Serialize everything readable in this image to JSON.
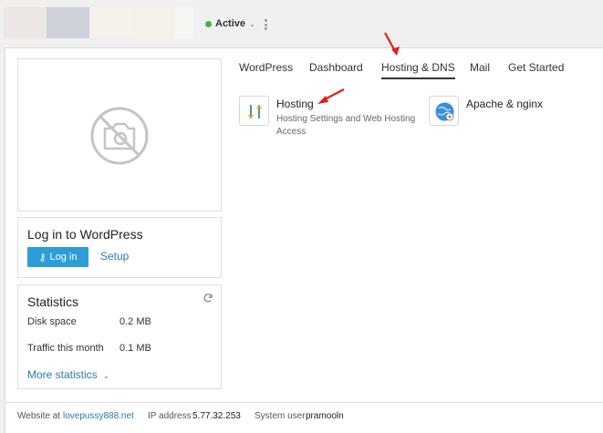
{
  "topbar": {
    "swatches": [
      "#ece7e4",
      "#cdd1da",
      "#f5f2ec",
      "#f4f2e8",
      "#f6f6f4"
    ],
    "status_label": "Active",
    "status_color": "#4caf50",
    "status_chevron": "⌄",
    "menu_icon": "kebab-menu-icon"
  },
  "preview": {
    "icon": "no-image-camera-icon"
  },
  "wordpress": {
    "title": "Log in to WordPress",
    "login_button": "Log in",
    "login_icon": "key-icon",
    "setup_link": "Setup"
  },
  "statistics": {
    "title": "Statistics",
    "refresh_icon": "refresh-icon",
    "rows": [
      {
        "label": "Disk space",
        "value": "0.2 MB"
      },
      {
        "label": "Traffic this month",
        "value": "0.1 MB"
      }
    ],
    "more_link": "More statistics",
    "more_chevron": "⌄"
  },
  "tabs": [
    {
      "label": "WordPress",
      "active": false
    },
    {
      "label": "Dashboard",
      "active": false
    },
    {
      "label": "Hosting & DNS",
      "active": true
    },
    {
      "label": "Mail",
      "active": false
    },
    {
      "label": "Get Started",
      "active": false
    }
  ],
  "tiles": [
    {
      "title": "Hosting",
      "description": "Hosting Settings and Web Hosting Access",
      "icon": "hosting-settings-icon"
    },
    {
      "title": "Apache & nginx",
      "description": "",
      "icon": "apache-nginx-globe-icon"
    }
  ],
  "footer": {
    "website_label": "Website at",
    "website_value": "lovepussy888.net",
    "ip_label": "IP address",
    "ip_value": "5.77.32.253",
    "user_label": "System user",
    "user_value": "pramooln"
  },
  "colors": {
    "accent": "#2b9ed9",
    "link": "#2a7bb0",
    "annotation_arrow": "#e0201b"
  }
}
